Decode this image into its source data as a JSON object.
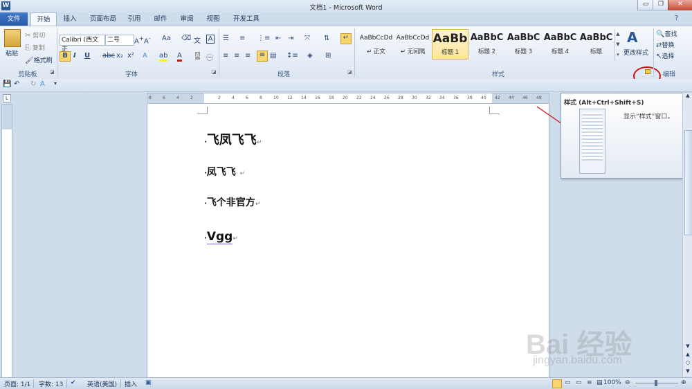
{
  "window": {
    "title": "文档1 - Microsoft Word",
    "app_icon": "W",
    "minimize": "▭",
    "maximize": "❐",
    "close": "✕"
  },
  "tabs": [
    "文件",
    "开始",
    "插入",
    "页面布局",
    "引用",
    "邮件",
    "审阅",
    "视图",
    "开发工具"
  ],
  "ribbon": {
    "clipboard": {
      "paste": "粘贴",
      "cut": "剪切",
      "copy": "复制",
      "format_painter": "格式刷",
      "label": "剪贴板"
    },
    "font": {
      "font_name": "Calibri (西文正",
      "font_size": "二号",
      "label": "字体"
    },
    "paragraph": {
      "label": "段落"
    },
    "styles": {
      "label": "样式",
      "items": [
        {
          "preview": "AaBbCcDd",
          "name": "↵ 正文"
        },
        {
          "preview": "AaBbCcDd",
          "name": "↵ 无间隔"
        },
        {
          "preview": "AaBb",
          "name": "标题 1"
        },
        {
          "preview": "AaBbC",
          "name": "标题 2"
        },
        {
          "preview": "AaBbC",
          "name": "标题 3"
        },
        {
          "preview": "AaBbC",
          "name": "标题 4"
        },
        {
          "preview": "AaBbC",
          "name": "标题"
        }
      ],
      "change_styles": "更改样式"
    },
    "editing": {
      "find": "查找",
      "replace": "替换",
      "select": "选择",
      "label": "编辑"
    }
  },
  "ruler": {
    "h_ticks": [
      "8",
      "6",
      "4",
      "2",
      "",
      "2",
      "4",
      "6",
      "8",
      "10",
      "12",
      "14",
      "16",
      "18",
      "20",
      "22",
      "24",
      "26",
      "28",
      "30",
      "32",
      "34",
      "36",
      "38",
      "40",
      "42",
      "44",
      "46",
      "48"
    ]
  },
  "document": {
    "paragraphs": [
      {
        "text": "飞凤飞飞",
        "mark": "↵"
      },
      {
        "text": "凤飞飞",
        "mark": "· ↵"
      },
      {
        "text": "飞个非官方",
        "mark": "↵"
      },
      {
        "text": "Vgg",
        "mark": "↵"
      }
    ]
  },
  "tooltip": {
    "title": "样式 (Alt+Ctrl+Shift+S)",
    "description": "显示“样式”窗口。"
  },
  "status": {
    "page": "页面: 1/1",
    "words": "字数: 13",
    "language": "英语(美国)",
    "insert_mode": "插入",
    "zoom": "100%"
  },
  "watermark": {
    "text": "Bai 经验",
    "url": "jingyan.baidu.com"
  },
  "colors": {
    "accent": "#2b5797",
    "ribbon_bg": "#dce6f2",
    "highlight_red": "#d01010"
  }
}
